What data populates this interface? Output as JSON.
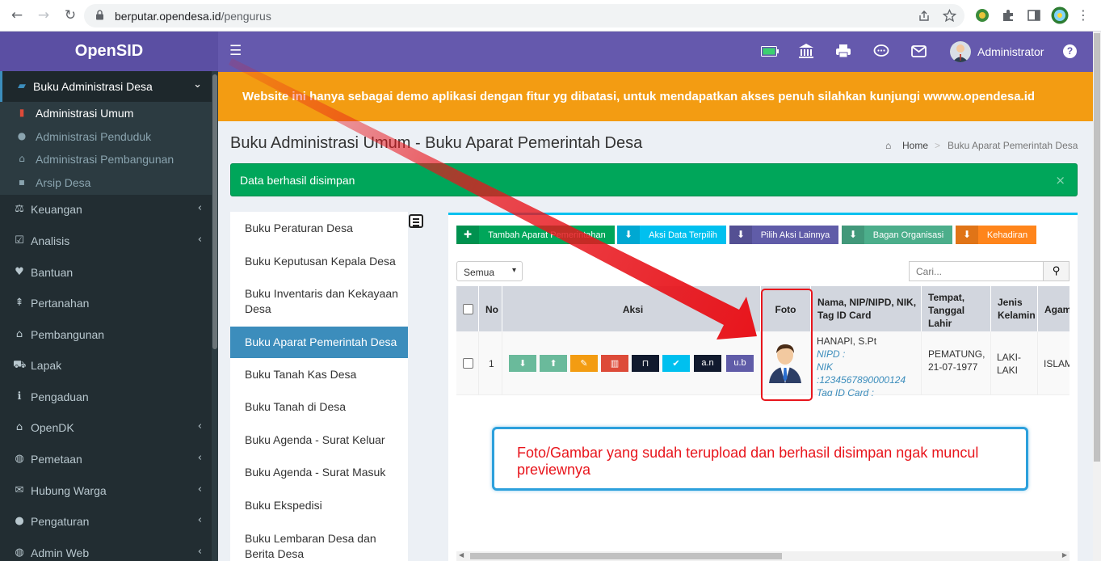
{
  "browser": {
    "back": "←",
    "forward": "→",
    "reload": "↻",
    "url_host": "berputar.opendesa.id",
    "url_path": "/pengurus"
  },
  "sidebar": {
    "brand": "OpenSID",
    "active_group": {
      "label": "Buku Administrasi Desa",
      "icon": "book-icon"
    },
    "sub_items": [
      {
        "label": "Administrasi Umum",
        "icon": "bookmark-icon",
        "active": true
      },
      {
        "label": "Administrasi Penduduk",
        "icon": "users-icon",
        "active": false
      },
      {
        "label": "Administrasi Pembangunan",
        "icon": "bank-icon",
        "active": false
      },
      {
        "label": "Arsip Desa",
        "icon": "archive-icon",
        "active": false
      }
    ],
    "items": [
      {
        "label": "Keuangan",
        "icon": "balance-scale-icon",
        "chevron": true
      },
      {
        "label": "Analisis",
        "icon": "check-square-icon",
        "chevron": true
      },
      {
        "label": "Bantuan",
        "icon": "heart-icon",
        "chevron": false
      },
      {
        "label": "Pertanahan",
        "icon": "map-signs-icon",
        "chevron": false
      },
      {
        "label": "Pembangunan",
        "icon": "bank-icon",
        "chevron": false
      },
      {
        "label": "Lapak",
        "icon": "cart-icon",
        "chevron": false
      },
      {
        "label": "Pengaduan",
        "icon": "info-icon",
        "chevron": false
      },
      {
        "label": "OpenDK",
        "icon": "bank-icon",
        "chevron": true
      },
      {
        "label": "Pemetaan",
        "icon": "globe-icon",
        "chevron": true
      },
      {
        "label": "Hubung Warga",
        "icon": "envelope-icon",
        "chevron": true
      },
      {
        "label": "Pengaturan",
        "icon": "users-icon",
        "chevron": true
      },
      {
        "label": "Admin Web",
        "icon": "globe-icon",
        "chevron": true
      }
    ]
  },
  "header": {
    "user": "Administrator",
    "colors": {
      "topbar": "#6559ad",
      "banner": "#f39c12",
      "success": "#00a65a",
      "sidebar": "#222d32"
    }
  },
  "banner": "Website ini hanya sebagai demo aplikasi dengan fitur yg dibatasi, untuk mendapatkan akses penuh silahkan kunjungi wwww.opendesa.id",
  "page": {
    "title": "Buku Administrasi Umum - Buku Aparat Pemerintah Desa",
    "breadcrumb_home": "Home",
    "breadcrumb_sep": ">",
    "breadcrumb_current": "Buku Aparat Pemerintah Desa",
    "alert": "Data berhasil disimpan",
    "alert_close": "×"
  },
  "book_list": [
    "Buku Peraturan Desa",
    "Buku Keputusan Kepala Desa",
    "Buku Inventaris dan Kekayaan Desa",
    "Buku Aparat Pemerintah Desa",
    "Buku Tanah Kas Desa",
    "Buku Tanah di Desa",
    "Buku Agenda - Surat Keluar",
    "Buku Agenda - Surat Masuk",
    "Buku Ekspedisi",
    "Buku Lembaran Desa dan Berita Desa"
  ],
  "toolbar": [
    {
      "label": "Tambah Aparat Pemerintahan",
      "icon": "plus-icon",
      "color": "#00a65a"
    },
    {
      "label": "Aksi Data Terpilih",
      "icon": "arrow-circle-down-icon",
      "color": "#00c0ef"
    },
    {
      "label": "Pilih Aksi Lainnya",
      "icon": "arrow-circle-down-icon",
      "color": "#605ca8"
    },
    {
      "label": "Bagan Organisasi",
      "icon": "arrow-circle-down-icon",
      "color": "#4cae8b"
    },
    {
      "label": "Kehadiran",
      "icon": "arrow-circle-down-icon",
      "color": "#ff851b"
    }
  ],
  "filter": {
    "selected": "Semua"
  },
  "search": {
    "placeholder": "Cari..."
  },
  "table": {
    "headers": [
      "No",
      "Aksi",
      "Foto",
      "Nama, NIP/NIPD, NIK, Tag ID Card",
      "Tempat, Tanggal Lahir",
      "Jenis Kelamin",
      "Agama"
    ],
    "row": {
      "no": "1",
      "action_buttons": [
        {
          "icon": "arrow-down-icon",
          "text": "",
          "color": "#6aba9b"
        },
        {
          "icon": "arrow-up-icon",
          "text": "",
          "color": "#6aba9b"
        },
        {
          "icon": "edit-icon",
          "text": "",
          "color": "#f39c12"
        },
        {
          "icon": "trash-icon",
          "text": "",
          "color": "#dd4b39"
        },
        {
          "icon": "unlock-icon",
          "text": "",
          "color": "#111a2e"
        },
        {
          "icon": "check-icon",
          "text": "",
          "color": "#00c0ef"
        },
        {
          "icon": "",
          "text": "a.n",
          "color": "#111a2e"
        },
        {
          "icon": "",
          "text": "u.b",
          "color": "#605ca8"
        }
      ],
      "nama": "HANAPI, S.Pt",
      "nipd": "NIPD :",
      "nik": "NIK :1234567890000124",
      "tag": "Tag ID Card :",
      "tempat": "PEMATUNG,",
      "tanggal": "21-07-1977",
      "jenis_1": "LAKI-",
      "jenis_2": "LAKI",
      "agama": "ISLAM"
    }
  },
  "annotation": {
    "note": "Foto/Gambar yang sudah terupload dan berhasil disimpan ngak muncul previewnya"
  }
}
